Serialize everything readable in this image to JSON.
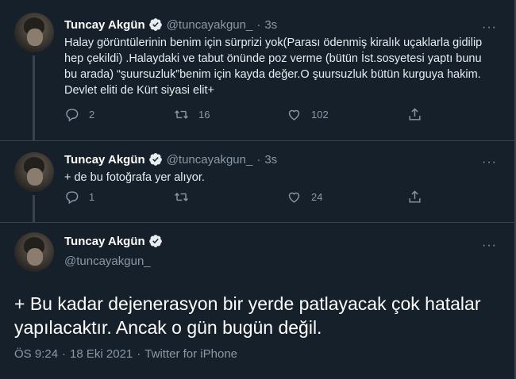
{
  "account": {
    "name": "Tuncay Akgün",
    "handle": "@tuncayakgun_",
    "verified_color": "#1d9bf0"
  },
  "tweets": [
    {
      "time": "3s",
      "text": "Halay görüntülerinin benim için sürprizi yok(Parası ödenmiş kiralık uçaklarla gidilip hep çekildi) .Halaydaki ve tabut önünde poz verme (bütün İst.sosyetesi yaptı bunu bu arada) “şuursuzluk”benim için kayda değer.O şuursuzluk bütün kurguya hakim. Devlet eliti de Kürt siyasi elit+",
      "replies": "2",
      "retweets": "16",
      "likes": "102"
    },
    {
      "time": "3s",
      "text": "+ de bu fotoğrafa yer alıyor.",
      "replies": "1",
      "retweets": "",
      "likes": "24"
    }
  ],
  "main_tweet": {
    "handle": "@tuncayakgun_",
    "text": "+ Bu kadar dejenerasyon bir yerde patlayacak çok hatalar yapılacaktır. Ancak o gün bugün değil.",
    "time": "ÖS 9:24",
    "date": "18 Eki 2021",
    "source": "Twitter for iPhone",
    "separator": "·"
  },
  "ui": {
    "dot": "·",
    "more": "···"
  },
  "icons": [
    "reply-icon",
    "retweet-icon",
    "like-icon",
    "share-icon",
    "verified-icon",
    "more-icon"
  ]
}
